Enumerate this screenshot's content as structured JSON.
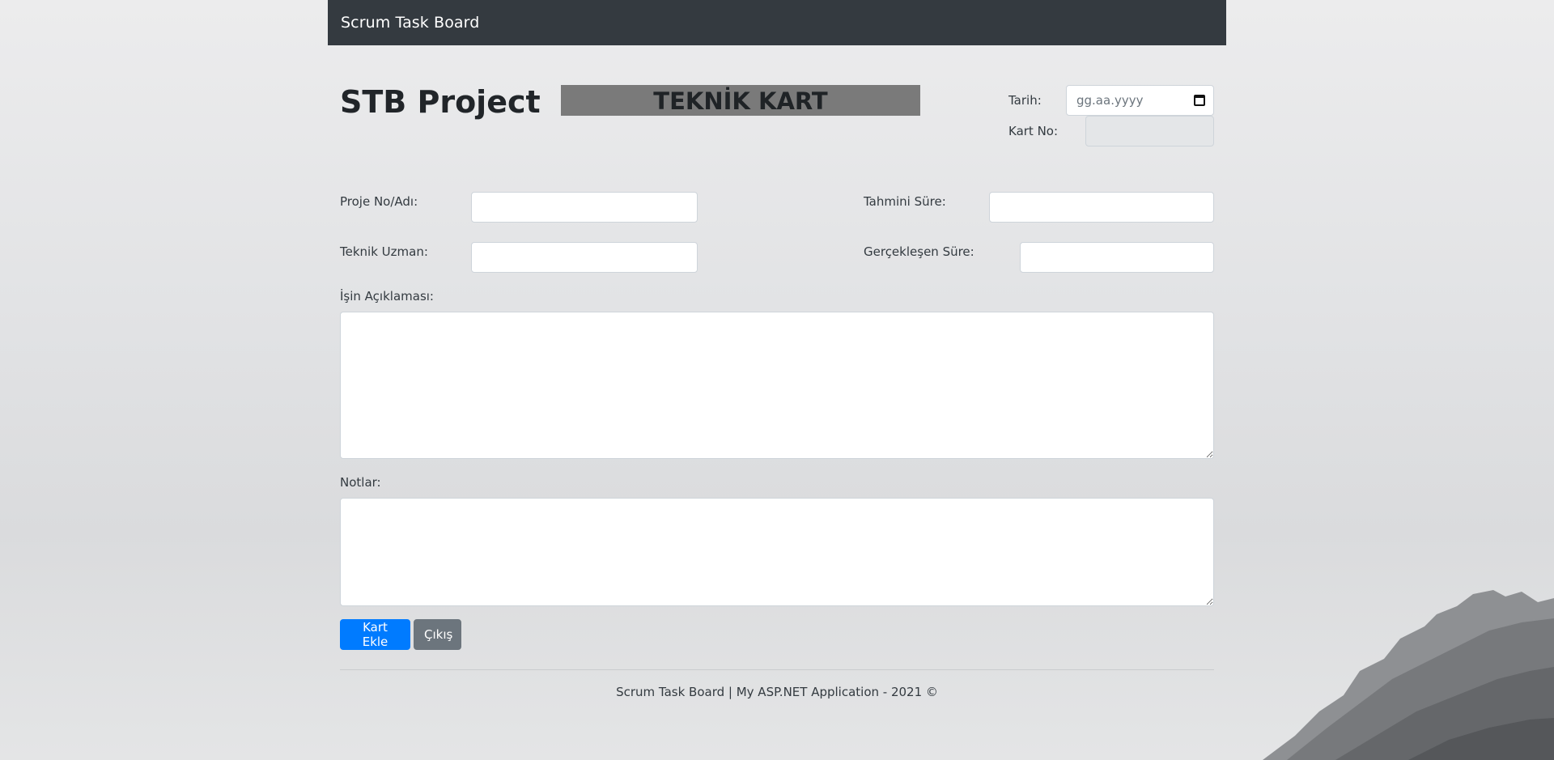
{
  "navbar": {
    "brand": "Scrum Task Board"
  },
  "page": {
    "title": "STB Project",
    "banner": "TEKNİK KART"
  },
  "form": {
    "tarih_label": "Tarih:",
    "tarih_placeholder": "gg.aa.yyyy",
    "kart_no_label": "Kart No:",
    "kart_no_value": "",
    "proje_label": "Proje No/Adı:",
    "proje_value": "",
    "tahmini_label": "Tahmini Süre:",
    "tahmini_value": "",
    "uzman_label": "Teknik Uzman:",
    "uzman_value": "",
    "gerceklesen_label": "Gerçekleşen Süre:",
    "gerceklesen_value": "",
    "aciklama_label": "İşin Açıklaması:",
    "aciklama_value": "",
    "notlar_label": "Notlar:",
    "notlar_value": ""
  },
  "buttons": {
    "add_label": "Kart Ekle",
    "exit_label": "Çıkış"
  },
  "footer": {
    "text": "Scrum Task Board | My ASP.NET Application - 2021 ©"
  },
  "icons": {
    "date_picker": "calendar-icon"
  },
  "colors": {
    "navbar_bg": "#343a40",
    "primary": "#007bff",
    "secondary": "#6c757d",
    "banner_bg": "#7a7a7a"
  }
}
